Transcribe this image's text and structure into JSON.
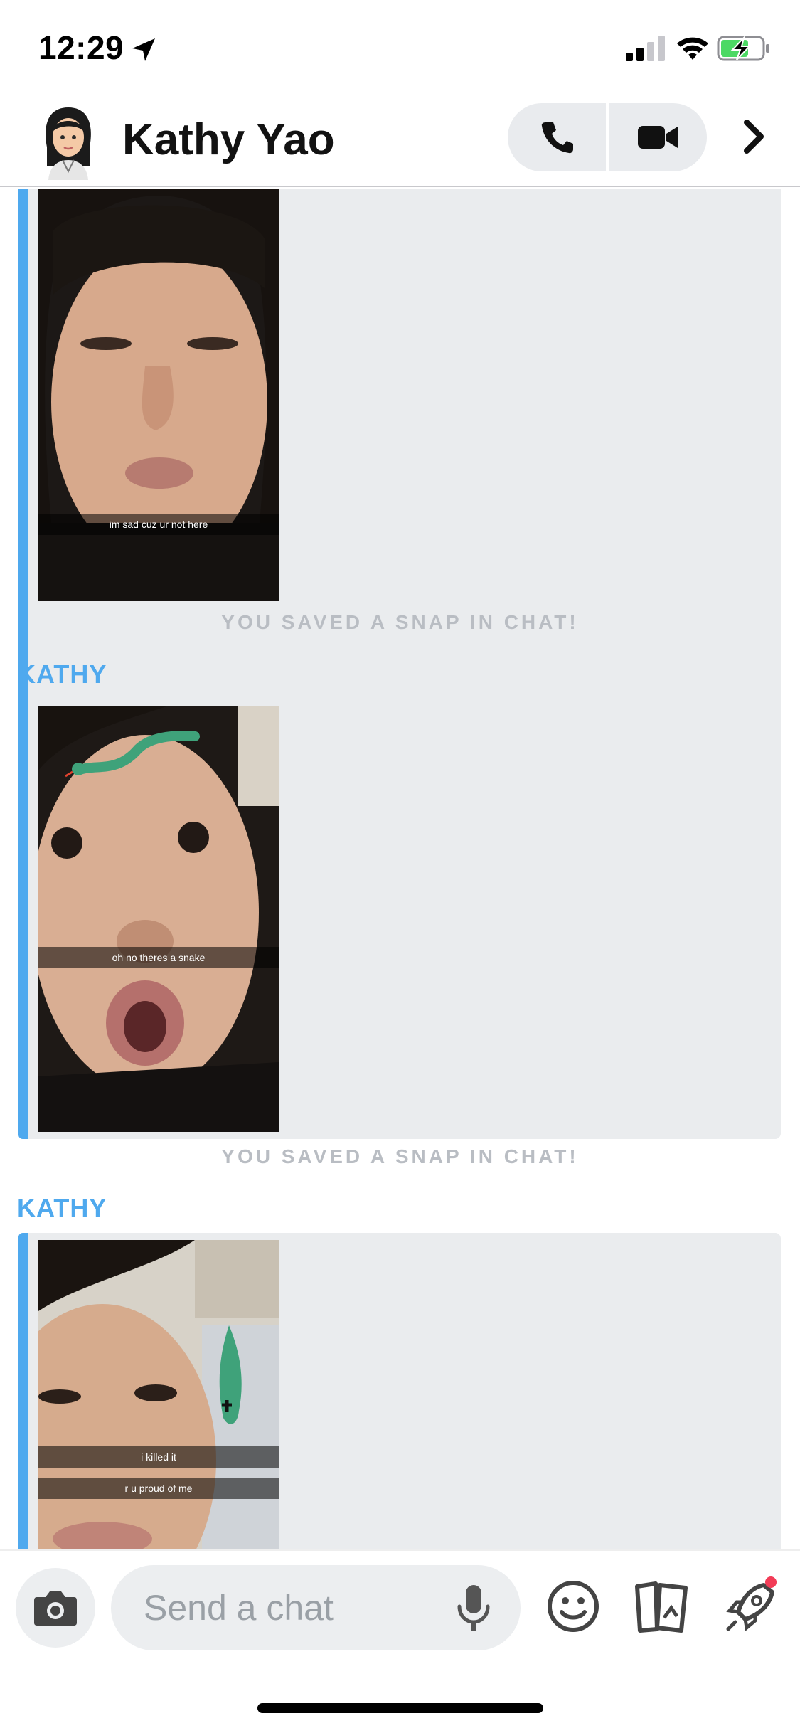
{
  "status_bar": {
    "time": "12:29"
  },
  "header": {
    "contact_name": "Kathy Yao"
  },
  "messages": [
    {
      "caption": "im sad cuz ur not here",
      "saved_note": "YOU SAVED A SNAP IN CHAT!"
    },
    {
      "sender": "KATHY",
      "caption": "oh no theres a snake",
      "saved_note": "YOU SAVED A SNAP IN CHAT!"
    },
    {
      "sender": "KATHY",
      "captions": [
        "i killed it",
        "r u proud of me"
      ]
    }
  ],
  "input": {
    "placeholder": "Send a chat"
  },
  "icons": {
    "location": "location-arrow-icon",
    "signal": "cellular-signal-icon",
    "wifi": "wifi-icon",
    "battery": "battery-charging-icon",
    "audio_call": "phone-icon",
    "video_call": "video-camera-icon",
    "more": "chevron-right-icon",
    "camera": "camera-icon",
    "mic": "microphone-icon",
    "emoji": "smiley-icon",
    "memories": "cards-icon",
    "games": "rocket-icon"
  },
  "colors": {
    "accent_blue": "#4fa9ee",
    "card_bg": "#eaecee",
    "saved_note": "#b9bdc3",
    "battery_green": "#4cd964",
    "notification_dot": "#f23c57"
  }
}
